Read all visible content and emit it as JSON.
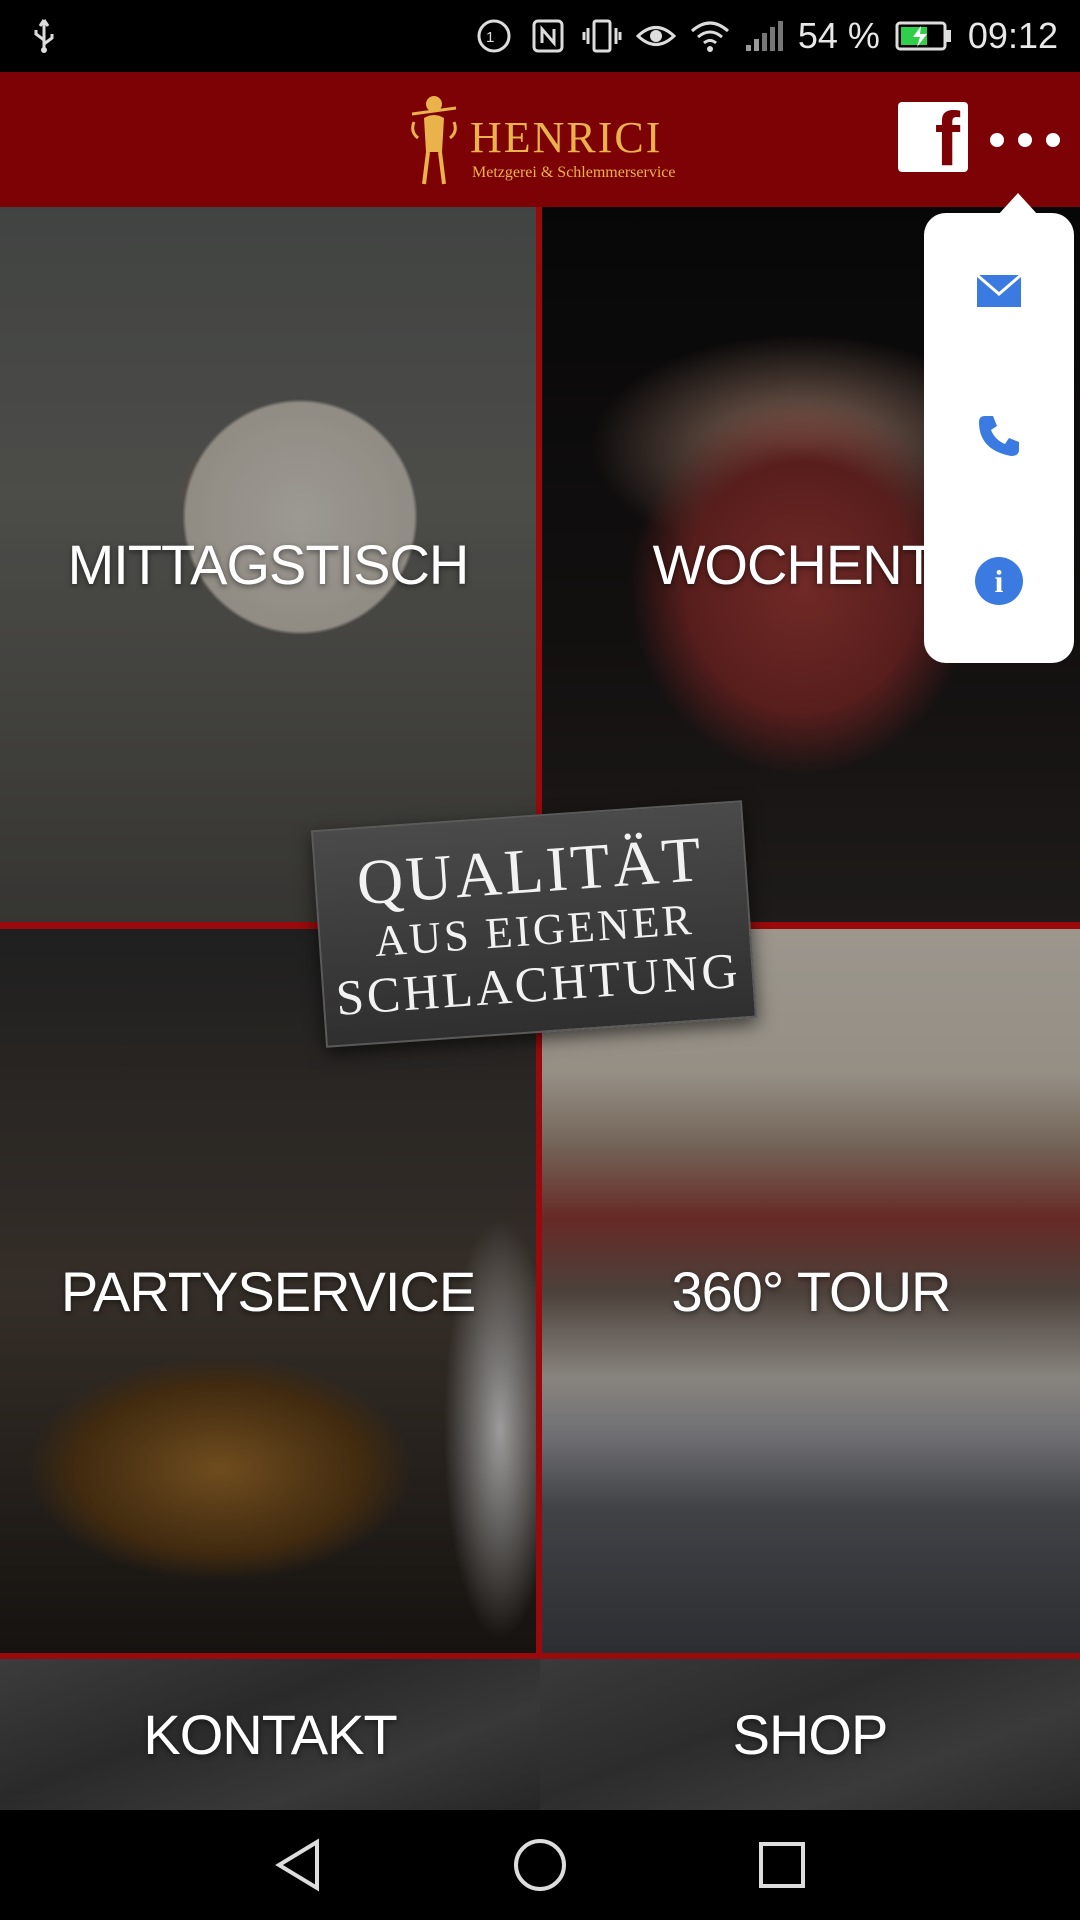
{
  "status_bar": {
    "battery_percent": "54 %",
    "time": "09:12",
    "icons": [
      "usb-icon",
      "nfc-badge-icon",
      "nfc-icon",
      "vibrate-icon",
      "eye-icon",
      "wifi-icon",
      "signal-icon",
      "battery-charging-icon"
    ]
  },
  "header": {
    "brand": "HENRICI",
    "tagline": "Metzgerei & Schlemmerservice",
    "facebook_glyph": "f",
    "background_color": "#7d0206",
    "accent_color": "#e9b24a"
  },
  "tiles": {
    "mittagstisch": "MITTAGSTISCH",
    "wochentipp": "WOCHENTI",
    "partyservice": "PARTYSERVICE",
    "tour": "360° TOUR",
    "kontakt": "KONTAKT",
    "shop": "SHOP"
  },
  "badge": {
    "line1": "QUALITÄT",
    "line2": "AUS EIGENER",
    "line3": "SCHLACHTUNG"
  },
  "popup_menu": {
    "items": [
      "mail-icon",
      "phone-icon",
      "info-icon"
    ],
    "info_glyph": "i",
    "icon_color": "#3b7ae0"
  },
  "navigation_bar": {
    "buttons": [
      "back-icon",
      "home-icon",
      "recents-icon"
    ]
  }
}
